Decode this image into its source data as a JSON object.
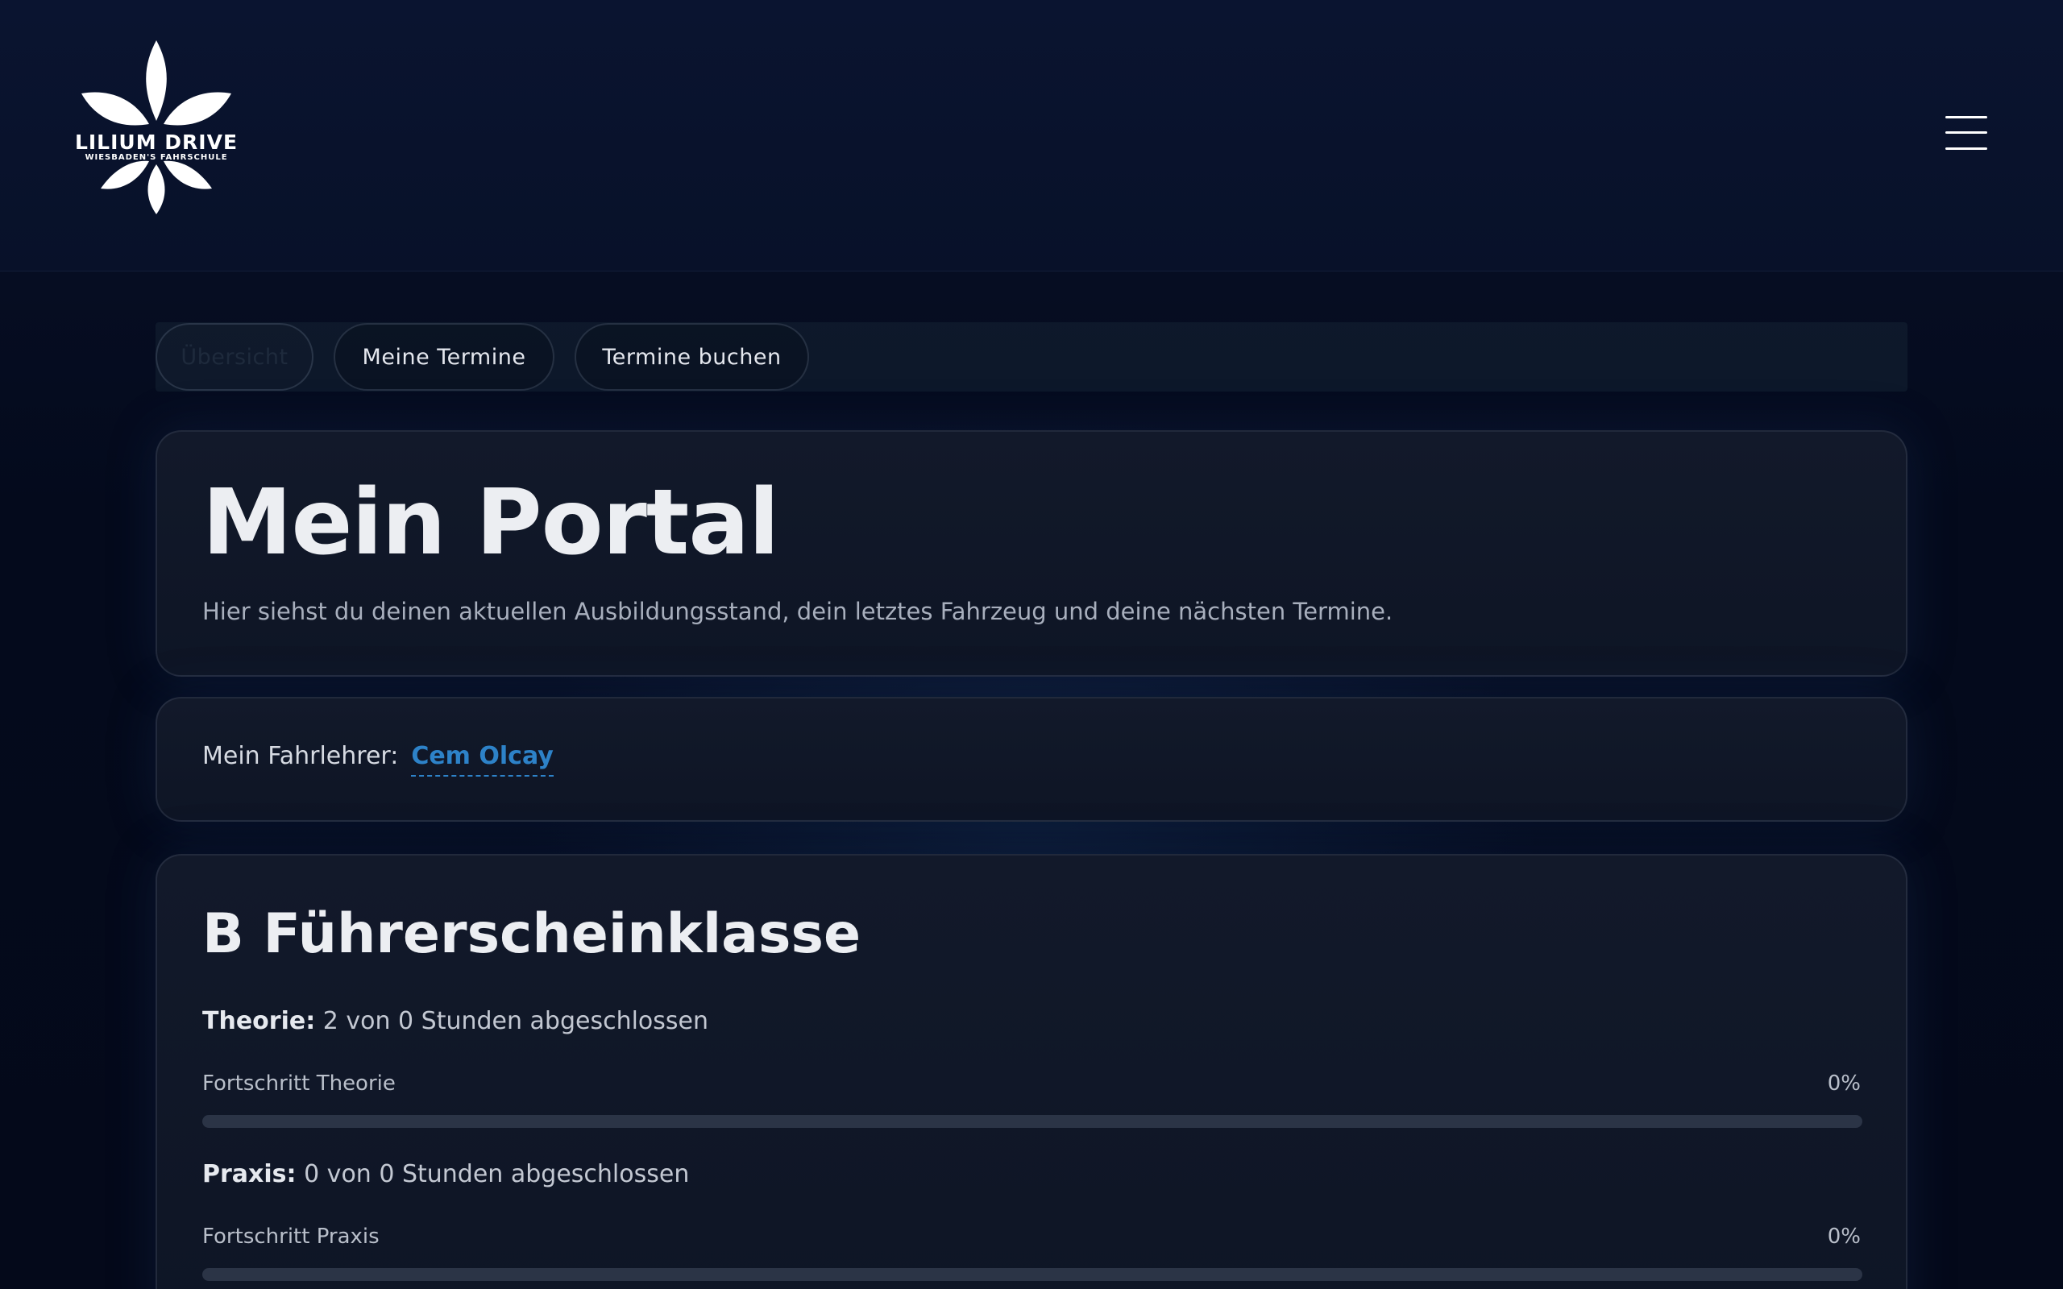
{
  "header": {
    "logo_name": "LILIUM DRIVE",
    "logo_tagline": "WIESBADEN'S FAHRSCHULE",
    "menu_icon": "hamburger-menu-icon"
  },
  "tabs": [
    {
      "label": "Übersicht",
      "active": true
    },
    {
      "label": "Meine Termine",
      "active": false
    },
    {
      "label": "Termine buchen",
      "active": false
    }
  ],
  "portal": {
    "title": "Mein Portal",
    "description": "Hier siehst du deinen aktuellen Ausbildungsstand, dein letztes Fahrzeug und deine nächsten Termine."
  },
  "teacher": {
    "label": "Mein Fahrlehrer:",
    "name": "Cem Olcay"
  },
  "license_class": {
    "title": "B Führerscheinklasse",
    "theory": {
      "label": "Theorie:",
      "text": "2 von 0 Stunden abgeschlossen",
      "progress_label": "Fortschritt Theorie",
      "progress_text": "0%",
      "progress_value": 0
    },
    "praxis": {
      "label": "Praxis:",
      "text": "0 von 0 Stunden abgeschlossen",
      "progress_label": "Fortschritt Praxis",
      "progress_text": "0%",
      "progress_value": 0
    }
  },
  "colors": {
    "accent": "#2d82c8",
    "background": "#050a18",
    "card": "#12192a",
    "progress_track": "#2b3446"
  }
}
